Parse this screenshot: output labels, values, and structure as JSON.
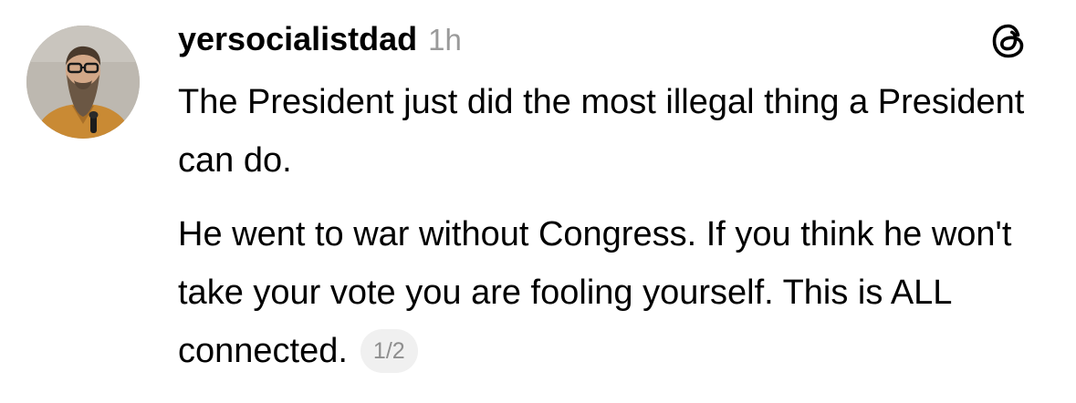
{
  "post": {
    "username": "yersocialistdad",
    "timestamp": "1h",
    "paragraphs": [
      "The President just did the most illegal thing a President can do.",
      "He went to war without Congress.  If you think he won't take your vote you are fooling yourself.  This is ALL connected."
    ],
    "page_indicator": "1/2"
  },
  "icons": {
    "app_logo": "threads-logo-icon"
  }
}
